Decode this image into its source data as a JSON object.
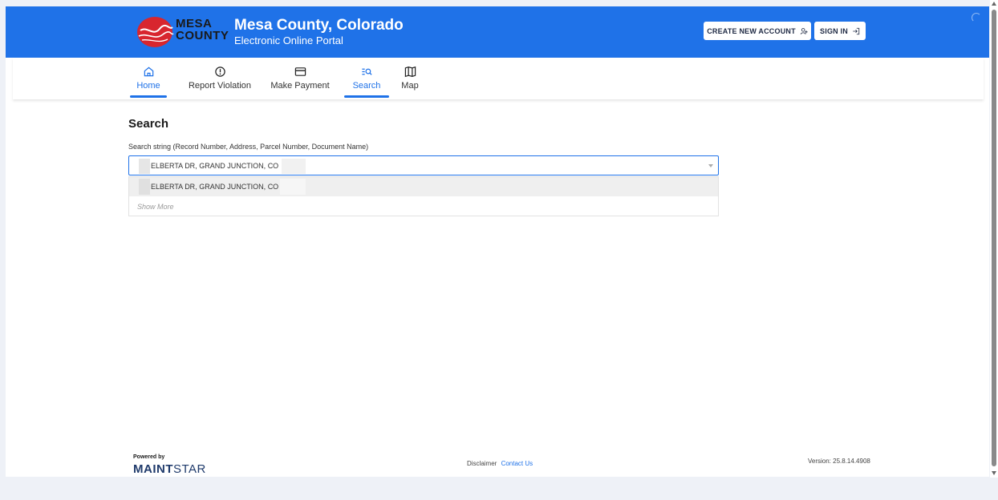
{
  "header": {
    "logo_line1": "MESA",
    "logo_line2": "COUNTY",
    "title": "Mesa County, Colorado",
    "subtitle": "Electronic Online Portal",
    "create_account_label": "CREATE NEW ACCOUNT",
    "sign_in_label": "SIGN IN",
    "brand_color": "#1f72e8"
  },
  "nav": {
    "items": [
      {
        "label": "Home",
        "icon": "home-icon",
        "active": true
      },
      {
        "label": "Report Violation",
        "icon": "alert-circle-icon",
        "active": false
      },
      {
        "label": "Make Payment",
        "icon": "credit-card-icon",
        "active": false
      },
      {
        "label": "Search",
        "icon": "search-list-icon",
        "active": true
      },
      {
        "label": "Map",
        "icon": "map-icon",
        "active": false
      }
    ]
  },
  "main": {
    "page_title": "Search",
    "search_label": "Search string (Record Number, Address, Parcel Number, Document Name)",
    "search_value": "ELBERTA DR, GRAND JUNCTION, CO",
    "suggestions": [
      "ELBERTA DR, GRAND JUNCTION, CO"
    ],
    "show_more": "Show More"
  },
  "footer": {
    "powered_by": "Powered by",
    "brand_bold": "MAINT",
    "brand_light": "STAR",
    "disclaimer": "Disclaimer",
    "contact": "Contact Us",
    "version": "Version: 25.8.14.4908"
  }
}
